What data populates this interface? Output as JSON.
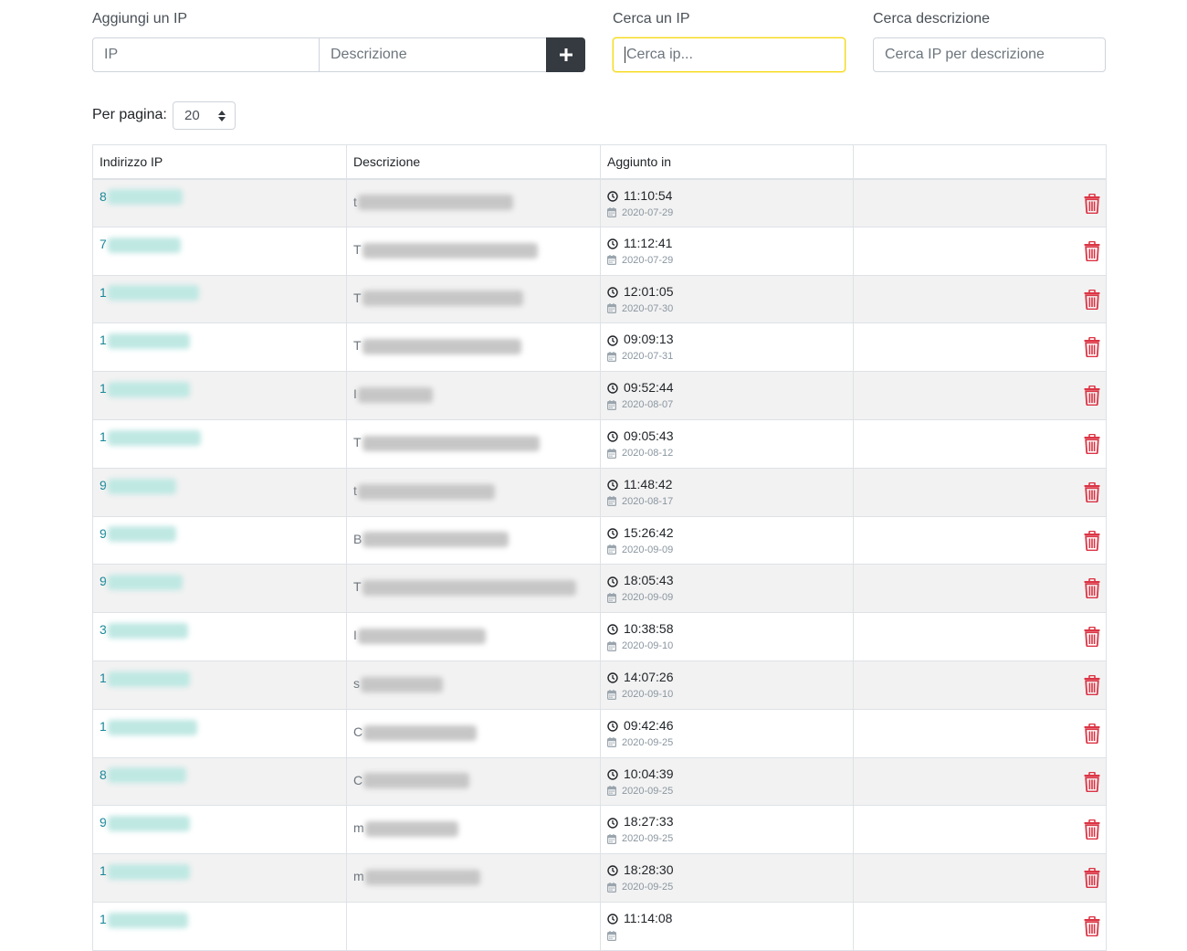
{
  "add_ip": {
    "label": "Aggiungi un IP",
    "ip_placeholder": "IP",
    "desc_placeholder": "Descrizione",
    "add_button": "+"
  },
  "search_ip": {
    "label": "Cerca un IP",
    "placeholder": "Cerca ip..."
  },
  "search_desc": {
    "label": "Cerca descrizione",
    "placeholder": "Cerca IP per descrizione"
  },
  "per_page": {
    "label": "Per pagina:",
    "value": "20"
  },
  "table": {
    "headers": [
      "Indirizzo IP",
      "Descrizione",
      "Aggiunto in",
      ""
    ],
    "rows": [
      {
        "ip": "8",
        "desc": "t",
        "time": "11:10:54",
        "date": "2020-07-29"
      },
      {
        "ip": "7",
        "desc": "T",
        "time": "11:12:41",
        "date": "2020-07-29"
      },
      {
        "ip": "1",
        "desc": "T",
        "time": "12:01:05",
        "date": "2020-07-30"
      },
      {
        "ip": "1",
        "desc": "T",
        "time": "09:09:13",
        "date": "2020-07-31"
      },
      {
        "ip": "1",
        "desc": "I",
        "time": "09:52:44",
        "date": "2020-08-07"
      },
      {
        "ip": "1",
        "desc": "T",
        "time": "09:05:43",
        "date": "2020-08-12"
      },
      {
        "ip": "9",
        "desc": "t",
        "time": "11:48:42",
        "date": "2020-08-17"
      },
      {
        "ip": "9",
        "desc": "B",
        "time": "15:26:42",
        "date": "2020-09-09"
      },
      {
        "ip": "9",
        "desc": "T",
        "time": "18:05:43",
        "date": "2020-09-09"
      },
      {
        "ip": "3",
        "desc": "I",
        "time": "10:38:58",
        "date": "2020-09-10"
      },
      {
        "ip": "1",
        "desc": "s",
        "time": "14:07:26",
        "date": "2020-09-10"
      },
      {
        "ip": "1",
        "desc": "C",
        "time": "09:42:46",
        "date": "2020-09-25"
      },
      {
        "ip": "8",
        "desc": "C",
        "time": "10:04:39",
        "date": "2020-09-25"
      },
      {
        "ip": "9",
        "desc": "m",
        "time": "18:27:33",
        "date": "2020-09-25"
      },
      {
        "ip": "1",
        "desc": "m",
        "time": "18:28:30",
        "date": "2020-09-25"
      },
      {
        "ip": "1",
        "desc": "",
        "time": "11:14:08",
        "date": ""
      }
    ]
  },
  "colors": {
    "ip_text": "#17a2b8",
    "delete_icon": "#dc3545",
    "add_button_bg": "#343a40",
    "focus_border": "#f5d80f"
  },
  "icons": {
    "add": "plus-icon",
    "time": "clock-icon",
    "date": "calendar-icon",
    "delete": "trash-icon",
    "select": "select-arrows-icon"
  }
}
